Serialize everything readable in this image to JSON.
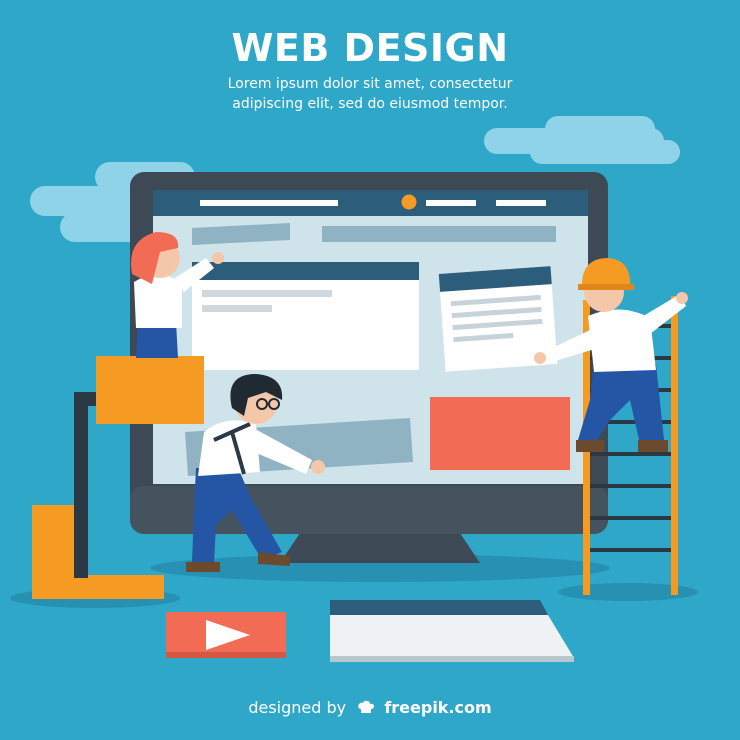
{
  "heading": "WEB DESIGN",
  "subheading": {
    "line1": "Lorem ipsum dolor sit amet, consectetur",
    "line2": "adipiscing elit, sed do eiusmod tempor."
  },
  "credit": {
    "prefix": "designed by",
    "brand": "freepik.com"
  },
  "colors": {
    "background": "#2fa7c9",
    "monitor_frame": "#3d4a55",
    "screen": "#cfe3ea",
    "header_bar": "#3a6e8f",
    "accent_orange": "#f59a23",
    "accent_coral": "#f26b55",
    "cloud": "#8fd3e8"
  },
  "icons": [
    "play-icon",
    "chef-hat-icon",
    "ladder",
    "desk-lamp"
  ]
}
